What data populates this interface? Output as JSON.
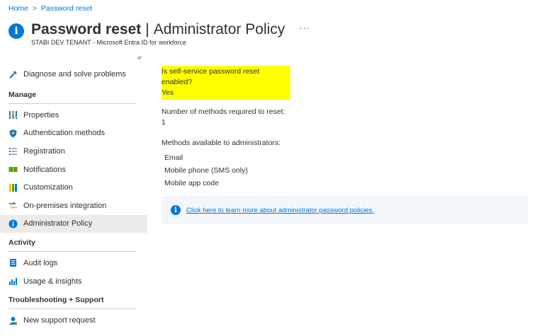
{
  "breadcrumb": {
    "home": "Home",
    "separator": ">",
    "current": "Password reset"
  },
  "header": {
    "title": "Password reset",
    "separator": "|",
    "subtitle": "Administrator Policy",
    "more": "···",
    "tenant": "STABI DEV TENANT - Microsoft Entra ID for workforce",
    "icon": "info-icon"
  },
  "sidebar": {
    "collapse": "«",
    "top_item": {
      "label": "Diagnose and solve problems",
      "icon": "wrench-icon"
    },
    "sections": [
      {
        "title": "Manage",
        "items": [
          {
            "label": "Properties",
            "icon": "sliders-icon",
            "color": "#0078d4"
          },
          {
            "label": "Authentication methods",
            "icon": "shield-icon",
            "color": "#0078d4"
          },
          {
            "label": "Registration",
            "icon": "list-icon",
            "color": "#605e5c"
          },
          {
            "label": "Notifications",
            "icon": "notification-icon",
            "color": "#57a300"
          },
          {
            "label": "Customization",
            "icon": "customization-icon",
            "color": "#ffb900"
          },
          {
            "label": "On-premises integration",
            "icon": "sync-icon",
            "color": "#ffb900"
          },
          {
            "label": "Administrator Policy",
            "icon": "info-icon",
            "color": "#0078d4",
            "selected": true
          }
        ]
      },
      {
        "title": "Activity",
        "items": [
          {
            "label": "Audit logs",
            "icon": "log-icon",
            "color": "#0078d4"
          },
          {
            "label": "Usage & insights",
            "icon": "chart-icon",
            "color": "#0078d4"
          }
        ]
      },
      {
        "title": "Troubleshooting + Support",
        "items": [
          {
            "label": "New support request",
            "icon": "person-icon",
            "color": "#0078d4"
          }
        ]
      }
    ]
  },
  "content": {
    "sspr_question": "Is self-service password reset enabled?",
    "sspr_answer": "Yes",
    "methods_required_label": "Number of methods required to reset:",
    "methods_required_value": "1",
    "methods_available_label": "Methods available to administrators:",
    "methods": [
      "Email",
      "Mobile phone (SMS only)",
      "Mobile app code"
    ]
  },
  "infobox": {
    "link_text": "Click here to learn more about administrator password policies."
  },
  "colors": {
    "accent": "#0078d4",
    "highlight": "#ffff00",
    "selected_bg": "#edebe9",
    "infobox_bg": "#f3f7fc"
  }
}
